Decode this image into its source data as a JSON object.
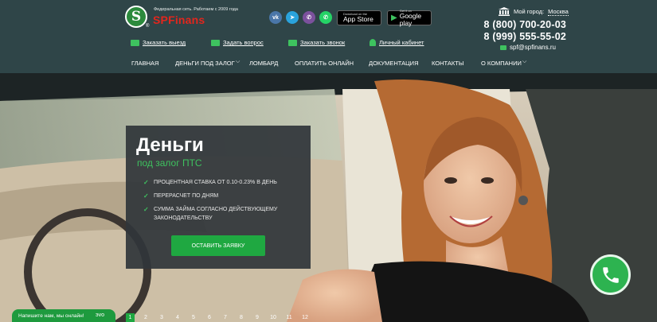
{
  "header": {
    "logo_letter": "S",
    "logo_reg": "®",
    "tagline": "Федеральная сеть. Работаем с 2009 года",
    "brand_sp": "SP",
    "brand_finans": "Finans",
    "socials": [
      {
        "icon": "vk-icon",
        "glyph": "vk"
      },
      {
        "icon": "telegram-icon",
        "glyph": "➤"
      },
      {
        "icon": "viber-icon",
        "glyph": "✆"
      },
      {
        "icon": "whatsapp-icon",
        "glyph": "✆"
      }
    ],
    "app_store": {
      "small": "Download on the",
      "big": "App Store"
    },
    "google_play": {
      "small": "Get it on",
      "big": "Google play"
    },
    "city_label": "Мой город:",
    "city_value": "Москва",
    "phone1": "8 (800) 700-20-03",
    "phone2": "8 (999) 555-55-02",
    "email": "spf@spfinans.ru",
    "quick_links": [
      {
        "label": "Заказать выезд",
        "icon": "car-icon"
      },
      {
        "label": "Задать вопрос",
        "icon": "question-icon"
      },
      {
        "label": "Заказать звонок",
        "icon": "phone-icon"
      },
      {
        "label": "Личный кабинет",
        "icon": "user-icon"
      }
    ]
  },
  "nav": {
    "items": [
      {
        "label": "ГЛАВНАЯ",
        "has_dropdown": false
      },
      {
        "label": "ДЕНЬГИ ПОД ЗАЛОГ",
        "has_dropdown": true
      },
      {
        "label": "ЛОМБАРД",
        "has_dropdown": false
      },
      {
        "label": "ОПЛАТИТЬ ОНЛАЙН",
        "has_dropdown": false
      },
      {
        "label": "ДОКУМЕНТАЦИЯ",
        "has_dropdown": false
      },
      {
        "label": "КОНТАКТЫ",
        "has_dropdown": false
      },
      {
        "label": "О КОМПАНИИ",
        "has_dropdown": true
      }
    ]
  },
  "hero": {
    "title": "Деньги",
    "subtitle": "под залог ПТС",
    "features": [
      "ПРОЦЕНТНАЯ СТАВКА ОТ 0.10-0.23% В ДЕНЬ",
      "ПЕРЕРАСЧЕТ ПО ДНЯМ",
      "СУММА ЗАЙМА СОГЛАСНО ДЕЙСТВУЮЩЕМУ ЗАКОНОДАТЕЛЬСТВУ"
    ],
    "cta_label": "ОСТАВИТЬ ЗАЯВКУ"
  },
  "chat": {
    "label": "Напишите нам, мы онлайн!",
    "suffix": "эvo"
  },
  "pager": {
    "pages": [
      "1",
      "2",
      "3",
      "4",
      "5",
      "6",
      "7",
      "8",
      "9",
      "10",
      "11",
      "12"
    ],
    "active": "1"
  },
  "colors": {
    "header_bg": "#2f4548",
    "accent_green": "#1fa841",
    "brand_red": "#e2261d"
  }
}
